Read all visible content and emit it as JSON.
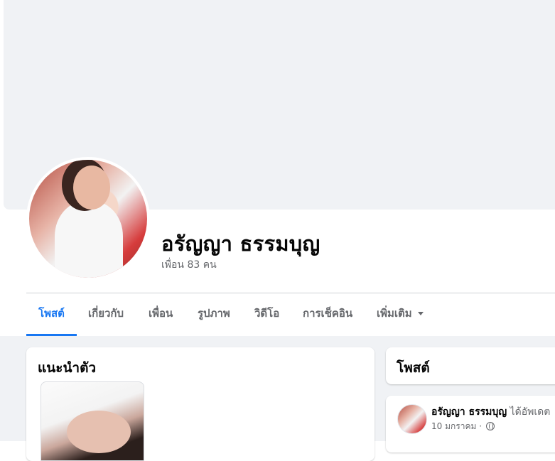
{
  "profile": {
    "name": "อรัญญา ธรรมบุญ",
    "friends": "เพื่อน 83 คน"
  },
  "tabs": [
    {
      "label": "โพสต์",
      "active": true
    },
    {
      "label": "เกี่ยวกับ"
    },
    {
      "label": "เพื่อน"
    },
    {
      "label": "รูปภาพ"
    },
    {
      "label": "วิดีโอ"
    },
    {
      "label": "การเช็คอิน"
    },
    {
      "label": "เพิ่มเติม"
    }
  ],
  "intro": {
    "title": "แนะนำตัว"
  },
  "posts": {
    "title": "โพสต์",
    "items": [
      {
        "author": "อรัญญา ธรรมบุญ",
        "action": "ได้อัพเดต",
        "date": "10 มกราคม",
        "separator": "·"
      }
    ]
  },
  "colors": {
    "accent": "#1877f2",
    "secondary_text": "#65676b",
    "background": "#f0f2f5"
  }
}
